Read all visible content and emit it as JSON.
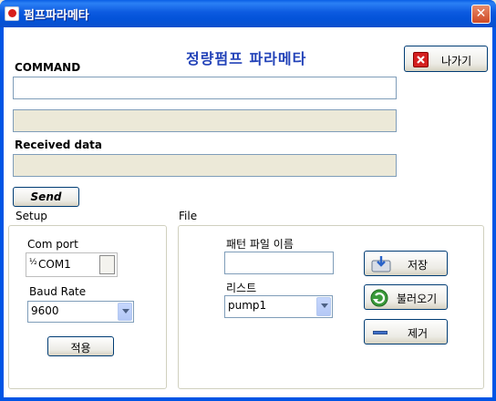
{
  "window": {
    "title": "펌프파라메타",
    "close_glyph": "✕"
  },
  "heading": "정량펌프 파라메타",
  "exit_button": {
    "label": "나가기",
    "icon": "red-x-icon"
  },
  "command": {
    "label": "COMMAND",
    "value": "",
    "echo": ""
  },
  "received": {
    "label": "Received data",
    "value": ""
  },
  "send_button": {
    "label": "Send"
  },
  "setup": {
    "title": "Setup",
    "com_port_label": "Com port",
    "com_port_value": "COM1",
    "baud_rate_label": "Baud Rate",
    "baud_rate_value": "9600",
    "apply_label": "적용"
  },
  "file": {
    "title": "File",
    "pattern_file_label": "패턴 파일 이름",
    "pattern_file_value": "",
    "list_label": "리스트",
    "list_value": "pump1",
    "save_label": "저장",
    "load_label": "불러오기",
    "remove_label": "제거"
  }
}
